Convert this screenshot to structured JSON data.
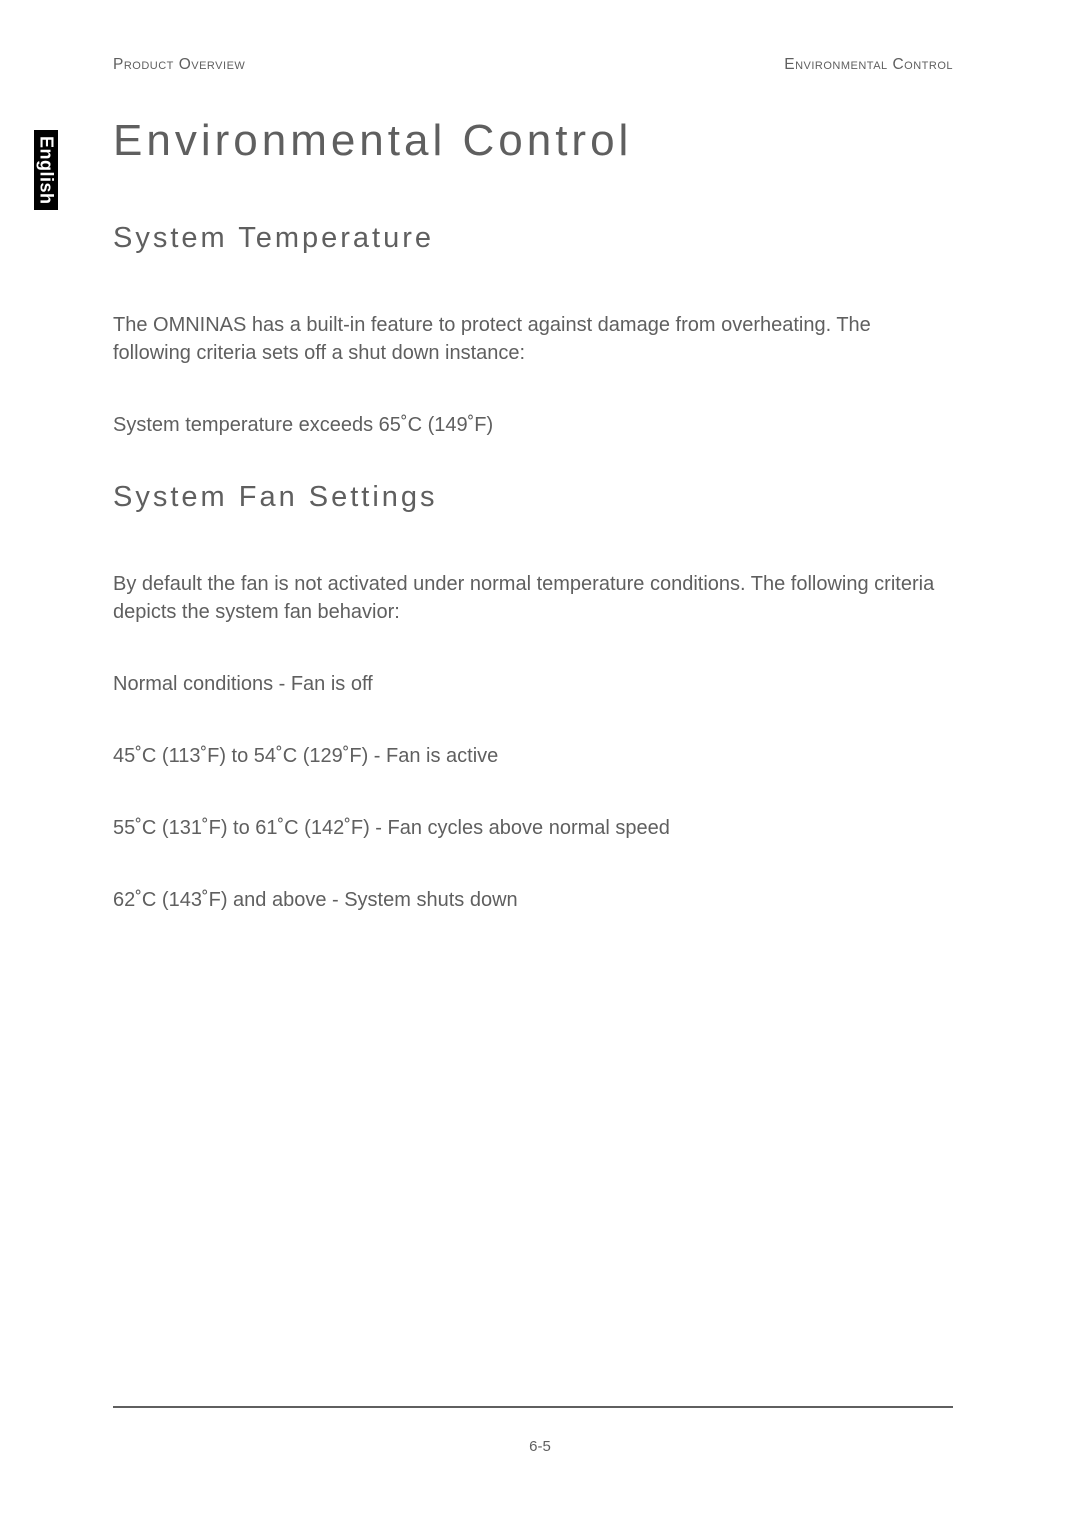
{
  "header": {
    "left": "Product Overview",
    "right": "Environmental Control"
  },
  "language_tab": "English",
  "title": "Environmental Control",
  "sections": [
    {
      "heading": "System Temperature",
      "paragraphs": [
        "The OMNINAS has a built-in feature to protect against damage from overheating. The following criteria sets off a shut down instance:",
        "System temperature exceeds 65˚C (149˚F)"
      ]
    },
    {
      "heading": "System Fan Settings",
      "paragraphs": [
        "By default the fan is not activated under normal temperature conditions. The following criteria depicts the system fan behavior:",
        "Normal conditions - Fan is off",
        "45˚C (113˚F) to 54˚C (129˚F) - Fan is active",
        "55˚C (131˚F) to 61˚C (142˚F) - Fan cycles above normal speed",
        "62˚C (143˚F) and above - System shuts down"
      ]
    }
  ],
  "page_number": "6-5"
}
